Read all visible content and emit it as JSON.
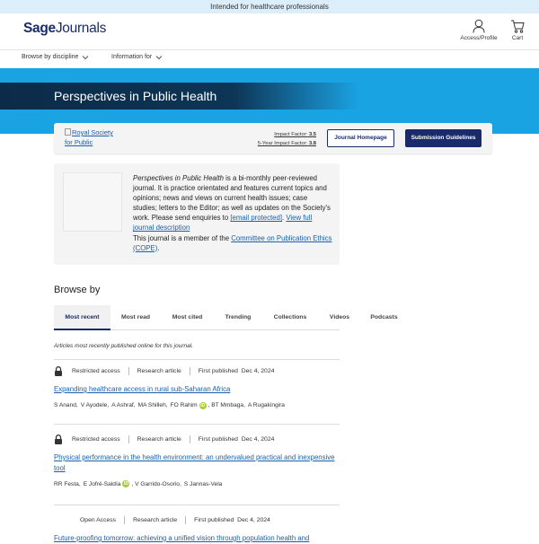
{
  "banner": {
    "text": "Intended for healthcare professionals"
  },
  "header": {
    "logo_part1": "Sage",
    "logo_part2": "Journals",
    "access_label": "Access/Profile",
    "cart_label": "Cart"
  },
  "nav": {
    "items": [
      {
        "label": "Browse by discipline"
      },
      {
        "label": "Information for"
      }
    ]
  },
  "hero": {
    "title": "Perspectives in Public Health"
  },
  "journal_card": {
    "logo_alt": "Royal Society for Public",
    "impact_factor_label": "Impact Factor:",
    "impact_factor_value": "3.5",
    "five_year_label": "5-Year Impact Factor:",
    "five_year_value": "3.8",
    "home_button": "Journal Homepage",
    "submission_button": "Submission Guidelines"
  },
  "description": {
    "journal_name": "Perspectives in Public Health",
    "text": " is a bi-monthly peer-reviewed journal. It is practice orientated and features current topics and opinions; news and views on current health issues; case studies; letters to the Editor; as well as updates on the Society's work. Please send enquiries to ",
    "email_link": "[email protected]",
    "sep": ". ",
    "full_desc_link": "View full journal description",
    "cope_text": "This journal is a member of the ",
    "cope_link": "Committee on Publication Ethics (COPE)",
    "end": "."
  },
  "browse": {
    "title": "Browse by",
    "tabs": [
      {
        "label": "Most recent"
      },
      {
        "label": "Most read"
      },
      {
        "label": "Most cited"
      },
      {
        "label": "Trending"
      },
      {
        "label": "Collections"
      },
      {
        "label": "Videos"
      },
      {
        "label": "Podcasts"
      }
    ],
    "note": "Articles most recently published online for this journal."
  },
  "articles": [
    {
      "access": "Restricted access",
      "type": "Research article",
      "published_label": "First published",
      "date": "Dec 4, 2024",
      "title": "Expanding healthcare access in rural sub-Saharan Africa",
      "authors": [
        {
          "name": "S Anand,"
        },
        {
          "name": "V Ayodele,"
        },
        {
          "name": "A Ashraf,"
        },
        {
          "name": "MA Shilleh,"
        },
        {
          "name": "FO Rahim"
        },
        {
          "name": ", BT Mmbaga,"
        },
        {
          "name": "A Rugakingira"
        }
      ]
    },
    {
      "access": "Restricted access",
      "type": "Research article",
      "published_label": "First published",
      "date": "Dec 4, 2024",
      "title": "Physical performance in the health environment: an undervalued practical and inexpensive tool",
      "authors": [
        {
          "name": "RR Festa,"
        },
        {
          "name": "E Jofré-Saldía"
        },
        {
          "name": ", V Garrido-Osorio,"
        },
        {
          "name": "S Jannas-Vela"
        }
      ]
    },
    {
      "access": "Open Access",
      "type": "Research article",
      "published_label": "First published",
      "date": "Dec 4, 2024",
      "title": "Future-proofing tomorrow: achieving a unified vision through population health and"
    }
  ],
  "icons": {
    "lock": "lock-icon",
    "orcid": "orcid-icon",
    "orcid_glyph": "iD"
  },
  "colors": {
    "brand": "#1a2b6b",
    "hero": "#1aa3e3",
    "link": "#1b5faa",
    "orcid": "#a6ce39"
  }
}
